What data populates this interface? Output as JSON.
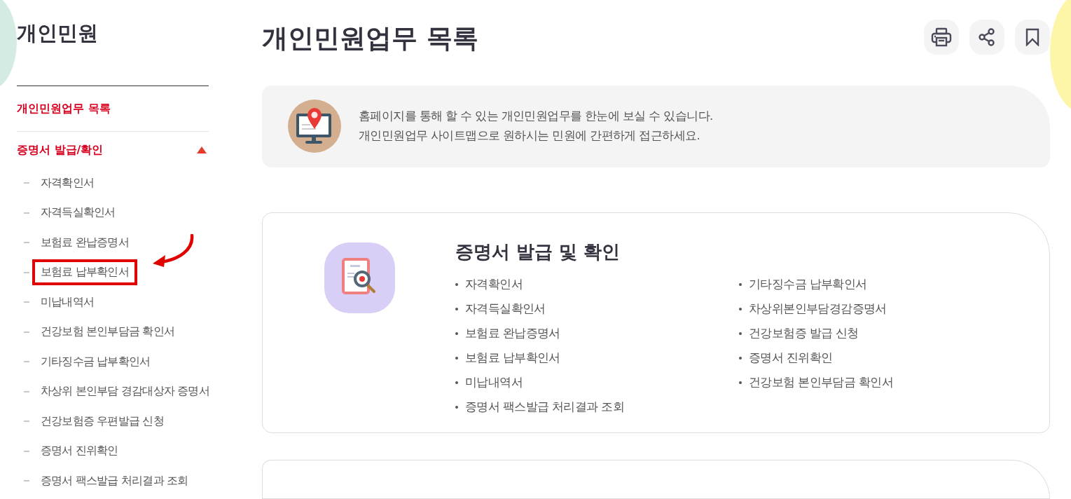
{
  "sidebar": {
    "title": "개인민원",
    "items": [
      {
        "label": "개인민원업무 목록",
        "selected": true
      },
      {
        "label": "증명서 발급/확인",
        "selected": true,
        "expanded": true,
        "children": [
          {
            "label": "자격확인서",
            "highlighted": false
          },
          {
            "label": "자격득실확인서",
            "highlighted": false
          },
          {
            "label": "보험료 완납증명서",
            "highlighted": false
          },
          {
            "label": "보험료 납부확인서",
            "highlighted": true
          },
          {
            "label": "미납내역서",
            "highlighted": false
          },
          {
            "label": "건강보험 본인부담금 확인서",
            "highlighted": false
          },
          {
            "label": "기타징수금 납부확인서",
            "highlighted": false
          },
          {
            "label": "차상위 본인부담 경감대상자 증명서",
            "highlighted": false
          },
          {
            "label": "건강보험증 우편발급 신청",
            "highlighted": false
          },
          {
            "label": "증명서 진위확인",
            "highlighted": false
          },
          {
            "label": "증명서 팩스발급 처리결과 조회",
            "highlighted": false
          }
        ]
      }
    ]
  },
  "page": {
    "title": "개인민원업무 목록",
    "actions": [
      {
        "kind": "print"
      },
      {
        "kind": "share"
      },
      {
        "kind": "bookmark"
      }
    ]
  },
  "intro": {
    "lines": [
      "홈페이지를 통해 할 수 있는 개인민원업무를 한눈에 보실 수 있습니다.",
      "개인민원업무 사이트맵으로 원하시는 민원에 간편하게 접근하세요."
    ]
  },
  "sections": [
    {
      "title": "증명서 발급 및 확인",
      "columns": [
        [
          "자격확인서",
          "자격득실확인서",
          "보험료 완납증명서",
          "보험료 납부확인서",
          "미납내역서",
          "증명서 팩스발급 처리결과 조회"
        ],
        [
          "기타징수금 납부확인서",
          "차상위본인부담경감증명서",
          "건강보험증 발급 신청",
          "증명서 진위확인",
          "건강보험 본인부담금 확인서"
        ]
      ]
    }
  ]
}
